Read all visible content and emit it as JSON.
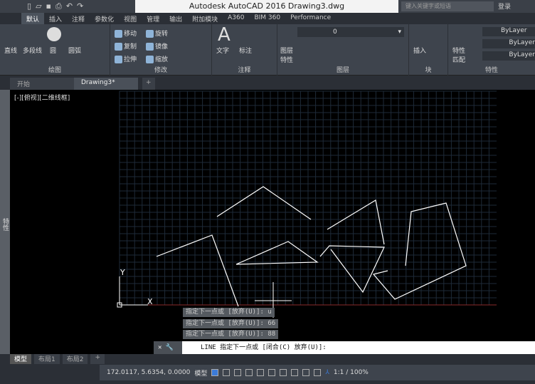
{
  "app": {
    "title": "Autodesk AutoCAD 2016    Drawing3.dwg",
    "search_placeholder": "键入关键字或短语",
    "login": "登录"
  },
  "menu_tabs": [
    "默认",
    "插入",
    "注释",
    "参数化",
    "视图",
    "管理",
    "输出",
    "附加模块",
    "A360",
    "BIM 360",
    "Performance"
  ],
  "ribbon": {
    "draw": {
      "title": "绘图",
      "items": [
        "直线",
        "多段线",
        "圆",
        "圆弧"
      ]
    },
    "modify": {
      "title": "修改",
      "items": [
        "移动",
        "旋转",
        "复制",
        "镜像",
        "拉伸",
        "缩放"
      ]
    },
    "annotation": {
      "title": "注释",
      "items": [
        "文字",
        "标注"
      ]
    },
    "layers": {
      "title": "图层",
      "items": [
        "图层特性"
      ],
      "current_layer": "0"
    },
    "block": {
      "title": "块",
      "items": [
        "插入"
      ]
    },
    "properties": {
      "title": "特性",
      "items": [
        "特性匹配"
      ],
      "color": "ByLayer",
      "linetype": "ByLayer",
      "lineweight": "ByLayer"
    }
  },
  "doc_tabs": [
    "开始",
    "Drawing3*"
  ],
  "viewport_label": "[-][俯视][二维线框]",
  "sidebar_label": "特性",
  "axis": {
    "x": "X",
    "y": "Y"
  },
  "tooltips": [
    "指定下一点或 [放弃(U)]: u",
    "指定下一点或 [放弃(U)]: 66",
    "指定下一点或 [放弃(U)]: 88"
  ],
  "command_line": "LINE 指定下一点或 [闭合(C) 放弃(U)]:",
  "layout_tabs": [
    "模型",
    "布局1",
    "布局2"
  ],
  "status": {
    "coords": "172.0117, 5.6354, 0.0000",
    "mode": "模型",
    "scale": "1:1 / 100%"
  },
  "colors": {
    "grid": "#1e2a38",
    "line": "#ffffff",
    "axis_red": "#8a2a2a"
  }
}
